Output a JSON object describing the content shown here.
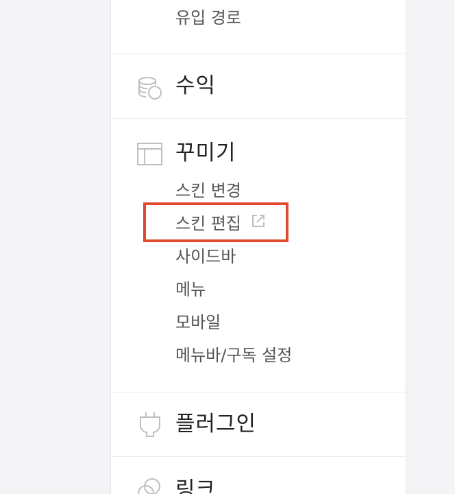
{
  "menu": {
    "stats_sub_items": [
      {
        "label": "유입 경로"
      }
    ],
    "revenue": {
      "title": "수익",
      "icon": "coins-icon"
    },
    "decorate": {
      "title": "꾸미기",
      "icon": "layout-icon",
      "items": [
        {
          "label": "스킨 변경"
        },
        {
          "label": "스킨 편집",
          "external": true,
          "highlighted": true
        },
        {
          "label": "사이드바"
        },
        {
          "label": "메뉴"
        },
        {
          "label": "모바일"
        },
        {
          "label": "메뉴바/구독 설정"
        }
      ]
    },
    "plugin": {
      "title": "플러그인",
      "icon": "plug-icon"
    },
    "link": {
      "title": "링크",
      "icon": "link-icon"
    }
  },
  "colors": {
    "highlight_border": "#e2492f",
    "icon_stroke": "#bdbdc4",
    "title_text": "#222222",
    "sub_text": "#555555"
  }
}
